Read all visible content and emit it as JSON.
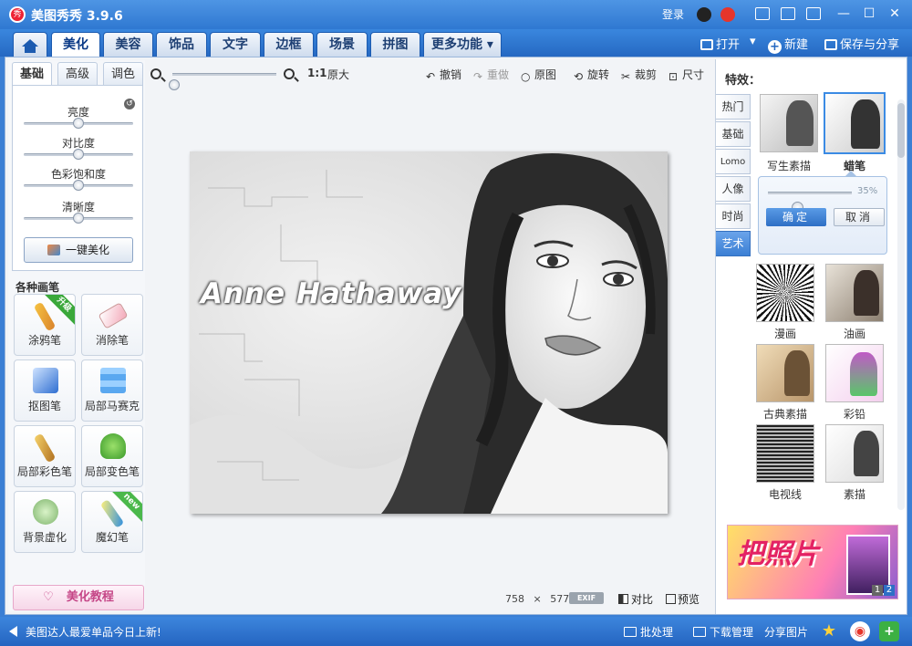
{
  "titlebar": {
    "title": "美图秀秀 3.9.6",
    "logo_text": "秀",
    "login": "登录",
    "window_controls": [
      "—",
      "☐",
      "✕"
    ]
  },
  "menu": {
    "tabs": [
      "美化",
      "美容",
      "饰品",
      "文字",
      "边框",
      "场景",
      "拼图",
      "更多功能 ▾"
    ],
    "active": "美化",
    "open_label": "打开",
    "open_arrow": "▾",
    "new_label": "新建",
    "save_label": "保存与分享"
  },
  "left": {
    "tabs": [
      "基础",
      "高级",
      "调色"
    ],
    "adjust": [
      {
        "label": "亮度",
        "value": 0.5
      },
      {
        "label": "对比度",
        "value": 0.5
      },
      {
        "label": "色彩饱和度",
        "value": 0.5
      },
      {
        "label": "清晰度",
        "value": 0.5
      }
    ],
    "one_key_label": "一键美化",
    "brush_section": "各种画笔",
    "brushes": [
      {
        "label": "涂鸦笔",
        "badge": "升级",
        "icon": "brush-icon"
      },
      {
        "label": "消除笔",
        "badge": "",
        "icon": "eraser-icon"
      },
      {
        "label": "抠图笔",
        "badge": "",
        "icon": "cutout-pen-icon"
      },
      {
        "label": "局部马赛克",
        "badge": "",
        "icon": "mosaic-icon"
      },
      {
        "label": "局部彩色笔",
        "badge": "",
        "icon": "color-brush-icon"
      },
      {
        "label": "局部变色笔",
        "badge": "",
        "icon": "paint-bucket-icon"
      },
      {
        "label": "背景虚化",
        "badge": "",
        "icon": "blur-icon"
      },
      {
        "label": "魔幻笔",
        "badge": "new",
        "icon": "magic-pen-icon"
      }
    ],
    "tutorial_label": "美化教程"
  },
  "toolbar": {
    "zoom_ratio": "1:1",
    "original_size": "原大",
    "undo": "撤销",
    "redo": "重做",
    "original": "原图",
    "rotate": "旋转",
    "crop": "裁剪",
    "size": "尺寸"
  },
  "canvas": {
    "caption": "Anne Hathaway",
    "width": "758",
    "times": "×",
    "height": "577",
    "exif": "EXIF",
    "compare": "对比",
    "preview": "预览"
  },
  "right": {
    "title": "特效：",
    "categories": [
      "热门",
      "基础",
      "Lomo",
      "人像",
      "时尚",
      "艺术"
    ],
    "active_category": "艺术",
    "top_effects": [
      {
        "label": "写生素描",
        "selected": false
      },
      {
        "label": "蜡笔",
        "selected": true
      }
    ],
    "panel": {
      "percent": "35%",
      "value": 0.35,
      "ok": "确定",
      "cancel": "取消"
    },
    "effects": [
      "漫画",
      "油画",
      "古典素描",
      "彩铅",
      "电视线",
      "素描"
    ],
    "ad_text": "把照片",
    "ad_pages": [
      "1",
      "2"
    ]
  },
  "statusbar": {
    "message": "美图达人最爱单品今日上新!",
    "batch": "批处理",
    "download": "下载管理",
    "share": "分享图片"
  },
  "colors": {
    "accent": "#3b7fd4",
    "selected_border": "#3b8be4",
    "tutorial_pink": "#c54687"
  }
}
